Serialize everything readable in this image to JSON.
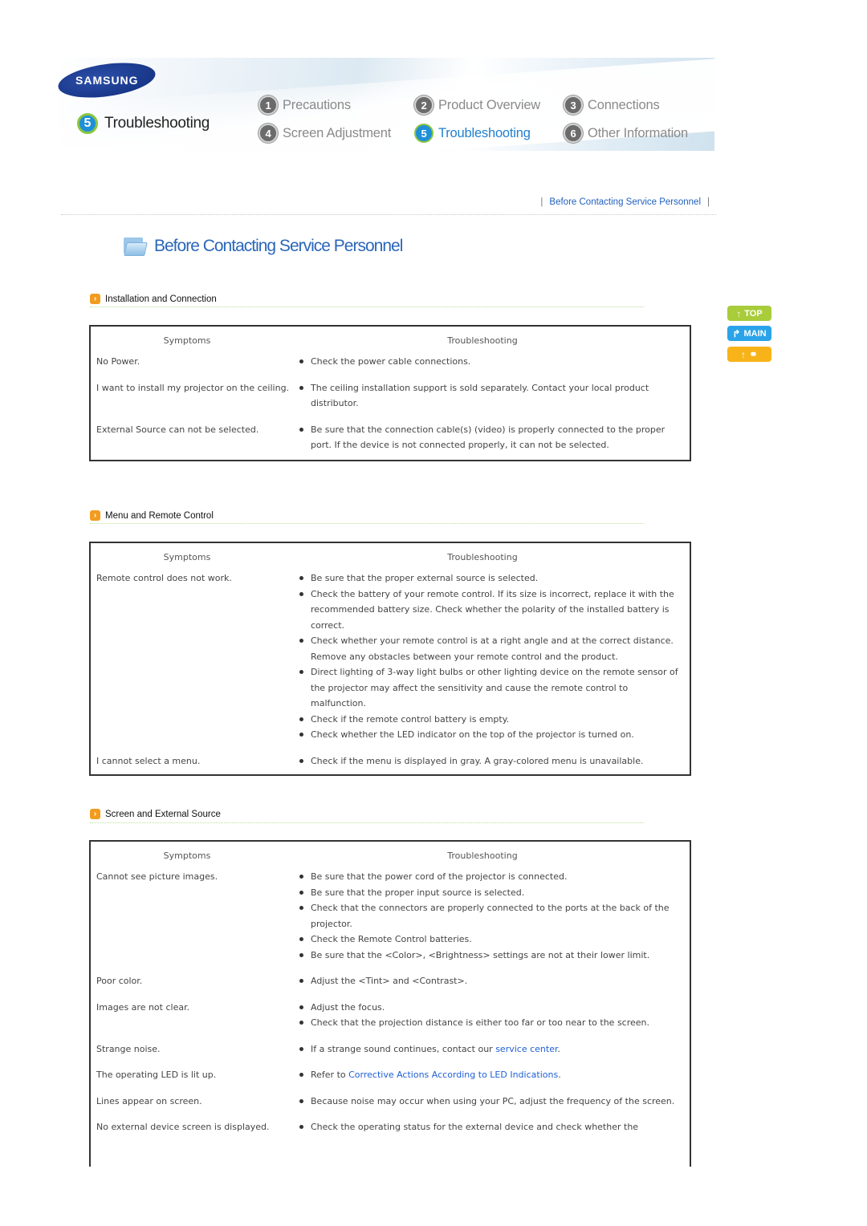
{
  "header": {
    "brand": "SAMSUNG",
    "current_section": {
      "number": "5",
      "label": "Troubleshooting"
    },
    "nav": [
      {
        "number": "1",
        "label": "Precautions",
        "active": false
      },
      {
        "number": "2",
        "label": "Product Overview",
        "active": false
      },
      {
        "number": "3",
        "label": "Connections",
        "active": false
      },
      {
        "number": "4",
        "label": "Screen Adjustment",
        "active": false
      },
      {
        "number": "5",
        "label": "Troubleshooting",
        "active": true
      },
      {
        "number": "6",
        "label": "Other Information",
        "active": false
      }
    ]
  },
  "breadcrumb": {
    "separator": "|",
    "current": "Before Contacting Service Personnel"
  },
  "page_title": "Before Contacting Service Personnel",
  "side_buttons": {
    "top": "TOP",
    "main": "MAIN",
    "back": "back"
  },
  "colors": {
    "link": "#1f5fd6",
    "nav_active": "#1f7fd0",
    "top_btn": "#a8cc3a",
    "main_btn": "#2ba3e8",
    "back_btn": "#f8b319",
    "section_icon": "#f29c1f"
  },
  "table_headers": {
    "symptoms": "Symptoms",
    "troubleshooting": "Troubleshooting"
  },
  "sections": [
    {
      "title": "Installation and Connection",
      "rows": [
        {
          "symptom": "No Power.",
          "fixes": [
            "Check the power cable connections."
          ]
        },
        {
          "symptom": "I want to install my projector on the ceiling.",
          "fixes": [
            "The ceiling installation support is sold separately. Contact your local product distributor."
          ]
        },
        {
          "symptom": "External Source can not be selected.",
          "fixes": [
            "Be sure that the connection cable(s) (video) is properly connected to the proper port. If the device is not connected properly, it can not be selected."
          ]
        }
      ]
    },
    {
      "title": "Menu and Remote Control",
      "rows": [
        {
          "symptom": "Remote control does not work.",
          "fixes": [
            "Be sure that the proper external source is selected.",
            "Check the battery of your remote control. If its size is incorrect, replace it with the recommended battery size. Check whether the polarity of the installed battery is correct.",
            "Check whether your remote control is at a right angle and at the correct distance. Remove any obstacles between your remote control and the product.",
            "Direct lighting of 3-way light bulbs or other lighting device on the remote sensor of the projector may affect the sensitivity and cause the remote control to malfunction.",
            "Check if the remote control battery is empty.",
            "Check whether the LED indicator on the top of the projector is turned on."
          ]
        },
        {
          "symptom": "I cannot select a menu.",
          "fixes": [
            "Check if the menu is displayed in gray. A gray-colored menu is unavailable."
          ]
        }
      ]
    },
    {
      "title": "Screen and External Source",
      "rows": [
        {
          "symptom": "Cannot see picture images.",
          "fixes": [
            "Be sure that the power cord of the projector is connected.",
            "Be sure that the proper input source is selected.",
            "Check that the connectors are properly connected to the ports at the back of the projector.",
            "Check the Remote Control batteries.",
            "Be sure that the <Color>, <Brightness> settings are not at their lower limit."
          ]
        },
        {
          "symptom": "Poor color.",
          "fixes": [
            "Adjust the <Tint> and <Contrast>."
          ]
        },
        {
          "symptom": "Images are not clear.",
          "fixes": [
            "Adjust the focus.",
            "Check that the projection distance is either too far or too near to the screen."
          ]
        },
        {
          "symptom": "Strange noise.",
          "fixes": [
            {
              "pre": "If a strange sound continues, contact our ",
              "link": "service center",
              "post": "."
            }
          ]
        },
        {
          "symptom": "The operating LED is lit up.",
          "fixes": [
            {
              "pre": "Refer to ",
              "link": "Corrective Actions According to LED Indications",
              "post": "."
            }
          ]
        },
        {
          "symptom": "Lines appear on screen.",
          "fixes": [
            "Because noise may occur when using your PC, adjust the frequency of the screen."
          ]
        },
        {
          "symptom": "No external device screen is displayed.",
          "fixes": [
            "Check the operating status for the external device and check whether the"
          ]
        }
      ]
    }
  ]
}
